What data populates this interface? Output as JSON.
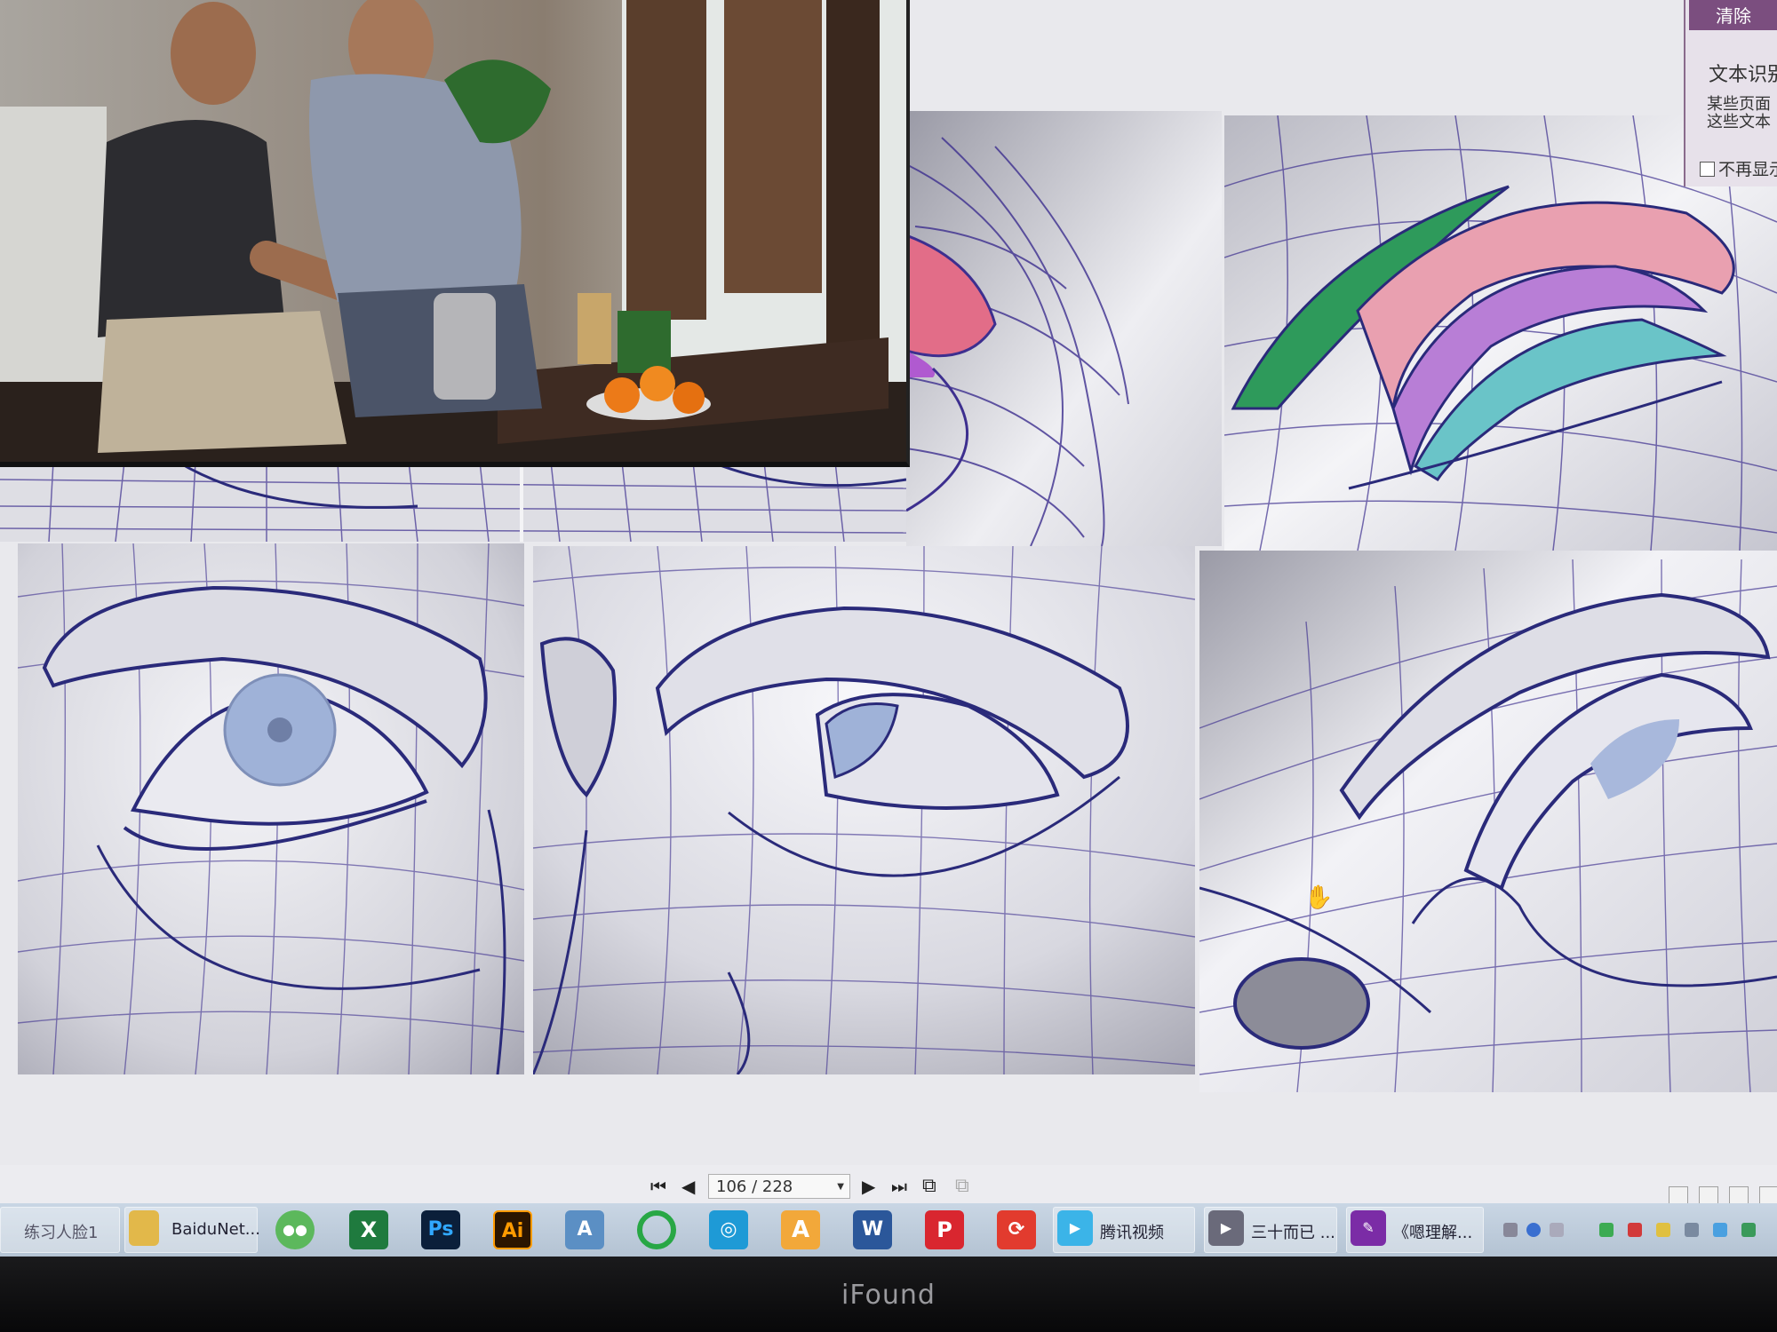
{
  "monitor_brand": "iFound",
  "side_popup": {
    "clear_label": "清除",
    "text_recognition": "文本识别",
    "desc_line1": "某些页面",
    "desc_line2": "这些文本",
    "no_show_label": "不再显示"
  },
  "pager": {
    "page_value": "106 / 228",
    "first_icon": "first-page-icon",
    "prev_icon": "prev-page-icon",
    "next_icon": "next-page-icon",
    "last_icon": "last-page-icon"
  },
  "taskbar": {
    "items": [
      {
        "label": "练习人脸1",
        "icon": "folder-icon"
      },
      {
        "label": "BaiduNet...",
        "icon": "folder-icon"
      },
      {
        "label": "",
        "icon": "wechat-icon"
      },
      {
        "label": "",
        "icon": "excel-icon"
      },
      {
        "label": "Ps",
        "icon": "photoshop-icon"
      },
      {
        "label": "Ai",
        "icon": "illustrator-icon"
      },
      {
        "label": "",
        "icon": "text-tool-icon"
      },
      {
        "label": "",
        "icon": "qihoo-icon"
      },
      {
        "label": "",
        "icon": "browser-icon"
      },
      {
        "label": "",
        "icon": "a-app-icon"
      },
      {
        "label": "",
        "icon": "word-icon"
      },
      {
        "label": "",
        "icon": "p-app-icon"
      },
      {
        "label": "",
        "icon": "red-app-icon"
      },
      {
        "label": "腾讯视频",
        "icon": "tencent-video-icon"
      },
      {
        "label": "三十而已 ...",
        "icon": "video-player-icon"
      },
      {
        "label": "《嗯理解...",
        "icon": "reader-icon"
      }
    ]
  },
  "colors": {
    "wire": "#3d2f8f",
    "pink": "#e07e96",
    "green": "#2e9a5b",
    "purple": "#b06ec6",
    "teal": "#6ac4c8",
    "taskbar": "#c2d0de"
  }
}
